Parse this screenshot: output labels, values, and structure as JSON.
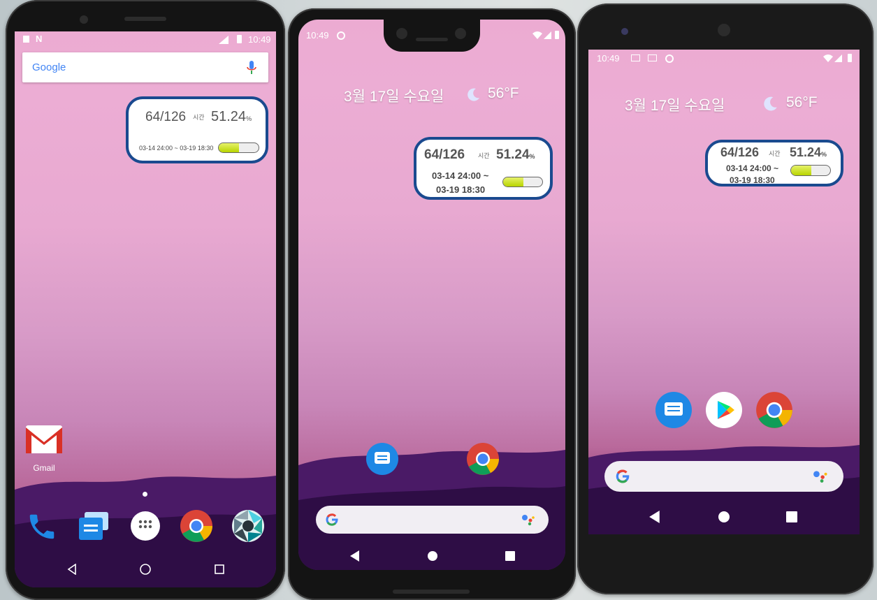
{
  "phone1": {
    "status_time": "10:49",
    "google_logo": "Google",
    "widget": {
      "fraction": "64/126",
      "hours_label": "시간",
      "percent": "51.24",
      "percent_unit": "%",
      "range": "03-14 24:00 ~ 03-19 18:30",
      "progress": 0.51
    },
    "gmail_label": "Gmail",
    "dock": [
      "phone-icon",
      "messages-icon",
      "app-drawer-icon",
      "chrome-icon",
      "camera-icon"
    ]
  },
  "phone2": {
    "status_time": "10:49",
    "date": "3월 17일 수요일",
    "temp": "56°F",
    "widget": {
      "fraction": "64/126",
      "hours_label": "시간",
      "percent": "51.24",
      "percent_unit": "%",
      "range_line1": "03-14 24:00 ~",
      "range_line2": "03-19 18:30",
      "progress": 0.51
    }
  },
  "phone3": {
    "status_time": "10:49",
    "date": "3월 17일 수요일",
    "temp": "56°F",
    "widget": {
      "fraction": "64/126",
      "hours_label": "시간",
      "percent": "51.24",
      "percent_unit": "%",
      "range_line1": "03-14 24:00 ~",
      "range_line2": "03-19 18:30",
      "progress": 0.51
    }
  },
  "colors": {
    "widget_border": "#1a4a8f",
    "progress_fill": "#c6de1a",
    "wallpaper_top": "#ecabd2"
  }
}
